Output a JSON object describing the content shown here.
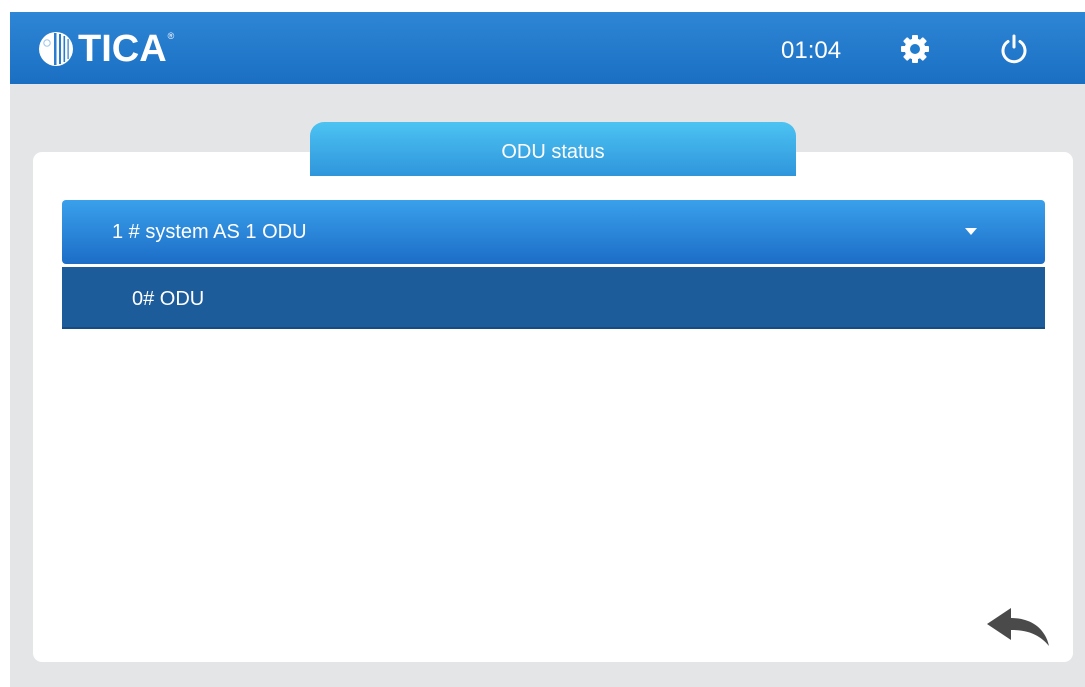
{
  "header": {
    "logo_text": "TICA",
    "logo_reg": "®",
    "time": "01:04",
    "icons": {
      "settings": "gear-icon",
      "power": "power-icon"
    }
  },
  "tab": {
    "label": "ODU status"
  },
  "system_dropdown": {
    "selected": "1 # system AS 1 ODU",
    "options": [
      "0# ODU"
    ]
  },
  "footer": {
    "back_icon": "back-arrow-icon"
  },
  "colors": {
    "header_blue": "#1a6fc2",
    "tab_blue": "#3aa7e6",
    "dropdown_blue": "#2a86dc",
    "option_blue": "#1d5c9b",
    "background": "#e4e5e7"
  }
}
